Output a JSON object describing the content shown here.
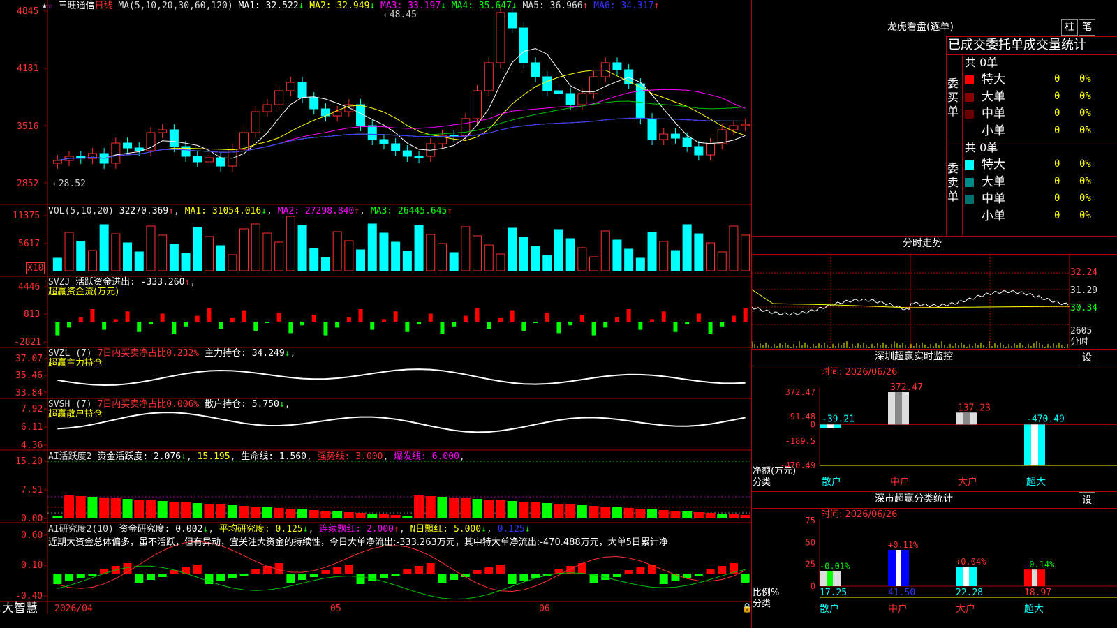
{
  "stock": {
    "name": "三旺通信",
    "period": "日线"
  },
  "ma_header": {
    "params": "MA(5,10,20,30,60,120)",
    "ma1": "MA1: 32.522",
    "ma2": "MA2: 32.949",
    "ma3": "MA3: 33.197",
    "ma4": "MA4: 35.647",
    "ma5": "MA5: 36.966",
    "ma6": "MA6: 34.317"
  },
  "price_axis": [
    "4845",
    "4181",
    "3516",
    "2852"
  ],
  "price_marks": {
    "high": "48.45",
    "low": "28.52"
  },
  "vol_header": {
    "params": "VOL(5,10,20)",
    "value": "32270.369",
    "ma1": "MA1: 31054.016",
    "ma2": "MA2: 27298.840",
    "ma3": "MA3: 26445.645"
  },
  "vol_axis": [
    "11375",
    "5617"
  ],
  "vol_unit": "X10",
  "svzj_header": {
    "name": "SVZJ",
    "label": "活跃资金进出: -333.260",
    "sub": "超赢资金流(万元)"
  },
  "svzj_axis": [
    "4446",
    "813",
    "-2821"
  ],
  "svzl_header": {
    "name": "SVZL (7)",
    "ratio": "7日内买卖净占比0.232%",
    "hold": "主力持仓: 34.249",
    "sub": "超赢主力持仓"
  },
  "svzl_axis": [
    "37.07",
    "35.46",
    "33.84"
  ],
  "svsh_header": {
    "name": "SVSH (7)",
    "ratio": "7日内买卖净占比0.006%",
    "hold": "散户持仓: 5.750",
    "sub": "超赢散户持仓"
  },
  "svsh_axis": [
    "7.92",
    "6.11",
    "4.36"
  ],
  "ai1_header": {
    "name": "AI活跃度2",
    "active": "资金活跃度: 2.076",
    "v2": "15.195",
    "life": "生命线: 1.560",
    "strong": "强势线: 3.000",
    "burst": "爆发线: 6.000"
  },
  "ai1_axis": [
    "15.20",
    "7.51",
    "0.00"
  ],
  "ai2_header": {
    "name": "AI研究度2(10)",
    "research": "资金研究度: 0.002",
    "avg": "平均研究度: 0.125",
    "red": "连续飘红: 2.000",
    "nday": "N日飘红: 5.000",
    "v5": "0.125"
  },
  "ai2_axis": [
    "0.60",
    "0.10",
    "-0.40"
  ],
  "ai2_text": "近期大资金总体偏多，虽不活跃，但有异动，宜关注大资金的持续性，今日大单净流出:-333.263万元，其中特大单净流出:-470.488万元，大单5日累计净",
  "bottom": {
    "brand": "大智慧",
    "date0": "2026/04",
    "m05": "05",
    "m06": "06"
  },
  "dragon": {
    "title": "龙虎看盘(逐单)",
    "btn1": "柱",
    "btn2": "笔",
    "tabs": "已成交委托单成交量统计",
    "buy_label": "委买单",
    "sell_label": "委卖单",
    "buy_total": "共 0单",
    "sell_total": "共 0单",
    "buy_rows": [
      {
        "name": "特大",
        "count": "0",
        "pct": "0%",
        "color": "#ff0000"
      },
      {
        "name": "大单",
        "count": "0",
        "pct": "0%",
        "color": "#8b0000"
      },
      {
        "name": "中单",
        "count": "0",
        "pct": "0%",
        "color": "#6b0000"
      },
      {
        "name": "小单",
        "count": "0",
        "pct": "0%",
        "color": "#000000"
      }
    ],
    "sell_rows": [
      {
        "name": "特大",
        "count": "0",
        "pct": "0%",
        "color": "#00ffff"
      },
      {
        "name": "大单",
        "count": "0",
        "pct": "0%",
        "color": "#008b8b"
      },
      {
        "name": "中单",
        "count": "0",
        "pct": "0%",
        "color": "#007070"
      },
      {
        "name": "小单",
        "count": "0",
        "pct": "0%",
        "color": "#000000"
      }
    ]
  },
  "intraday": {
    "title": "分时走势",
    "axis": [
      "32.24",
      "31.29",
      "30.34"
    ],
    "vol": "2605",
    "unit": "分时"
  },
  "monitor": {
    "title": "深圳超赢实时监控",
    "btn": "设",
    "time": "时间: 2026/06/26",
    "axis": [
      "372.47",
      "91.48",
      "0",
      "-189.5",
      "-470.49"
    ],
    "ylabel1": "净额(万元)",
    "ylabel2": "分类",
    "cats": [
      "散户",
      "中户",
      "大户",
      "超大"
    ],
    "values": [
      -39.21,
      372.47,
      137.23,
      -470.49
    ],
    "labels": [
      "-39.21",
      "372.47",
      "137.23",
      "-470.49"
    ]
  },
  "classify": {
    "title": "深市超赢分类统计",
    "btn": "设",
    "time": "时间: 2026/06/26",
    "axis": [
      "75",
      "50",
      "25",
      "0"
    ],
    "ylabel1": "比例%",
    "ylabel2": "分类",
    "cats": [
      "散户",
      "中户",
      "大户",
      "超大"
    ],
    "pcts": [
      17.25,
      41.5,
      22.28,
      18.97
    ],
    "pct_labels": [
      "17.25",
      "41.50",
      "22.28",
      "18.97"
    ],
    "changes": [
      "-0.01%",
      "+0.11%",
      "+0.04%",
      "-0.14%"
    ]
  }
}
